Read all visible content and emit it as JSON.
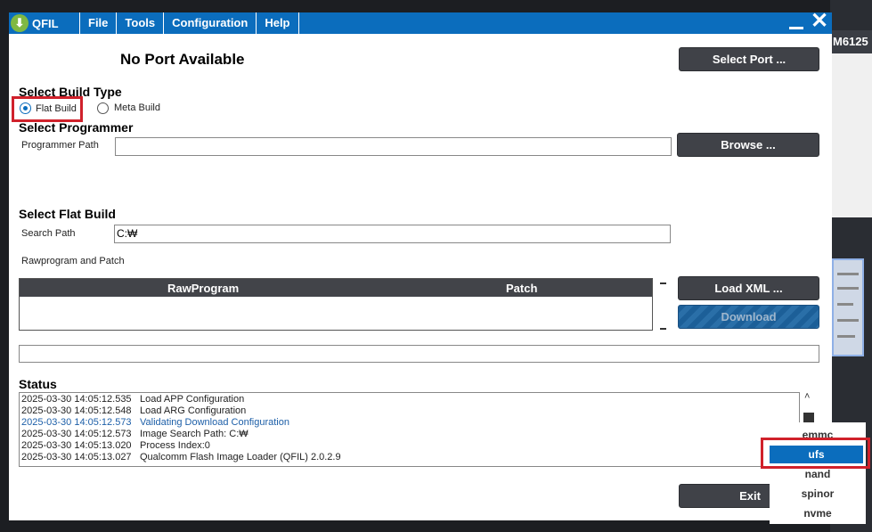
{
  "window": {
    "app_name": "QFIL",
    "menu": [
      "File",
      "Tools",
      "Configuration",
      "Help"
    ],
    "minimize_glyph": "",
    "close_glyph": "✕"
  },
  "background": {
    "partial_title": "M6125"
  },
  "port": {
    "status": "No Port Available",
    "select_button": "Select Port ..."
  },
  "build_type": {
    "heading": "Select Build Type",
    "options": [
      {
        "label": "Flat Build",
        "selected": true
      },
      {
        "label": "Meta Build",
        "selected": false
      }
    ]
  },
  "programmer": {
    "heading": "Select Programmer",
    "path_label": "Programmer Path",
    "path_value": "",
    "browse_button": "Browse ..."
  },
  "flat_build": {
    "heading": "Select Flat Build",
    "search_label": "Search Path",
    "search_value": "C:₩",
    "rawprogram_label": "Rawprogram and Patch",
    "columns": [
      "RawProgram",
      "Patch"
    ],
    "load_xml_button": "Load XML ...",
    "download_button": "Download"
  },
  "progress": {
    "value": 0
  },
  "status": {
    "heading": "Status",
    "log": [
      {
        "time": "2025-03-30 14:05:12.535",
        "message": "Load APP Configuration",
        "highlight": false
      },
      {
        "time": "2025-03-30 14:05:12.548",
        "message": "Load ARG Configuration",
        "highlight": false
      },
      {
        "time": "2025-03-30 14:05:12.573",
        "message": "Validating Download Configuration",
        "highlight": true
      },
      {
        "time": "2025-03-30 14:05:12.573",
        "message": "Image Search Path: C:₩",
        "highlight": false
      },
      {
        "time": "2025-03-30 14:05:13.020",
        "message": "Process Index:0",
        "highlight": false
      },
      {
        "time": "2025-03-30 14:05:13.027",
        "message": "Qualcomm Flash Image Loader (QFIL) 2.0.2.9",
        "highlight": false
      }
    ],
    "scroll_up_glyph": "˄"
  },
  "exit_button": "Exit",
  "storage_dropdown": {
    "options": [
      "emmc",
      "ufs",
      "nand",
      "spinor",
      "nvme"
    ],
    "selected": "ufs"
  },
  "colors": {
    "accent": "#0b6dbd",
    "highlight_box": "#d0212b",
    "button": "#404248"
  }
}
